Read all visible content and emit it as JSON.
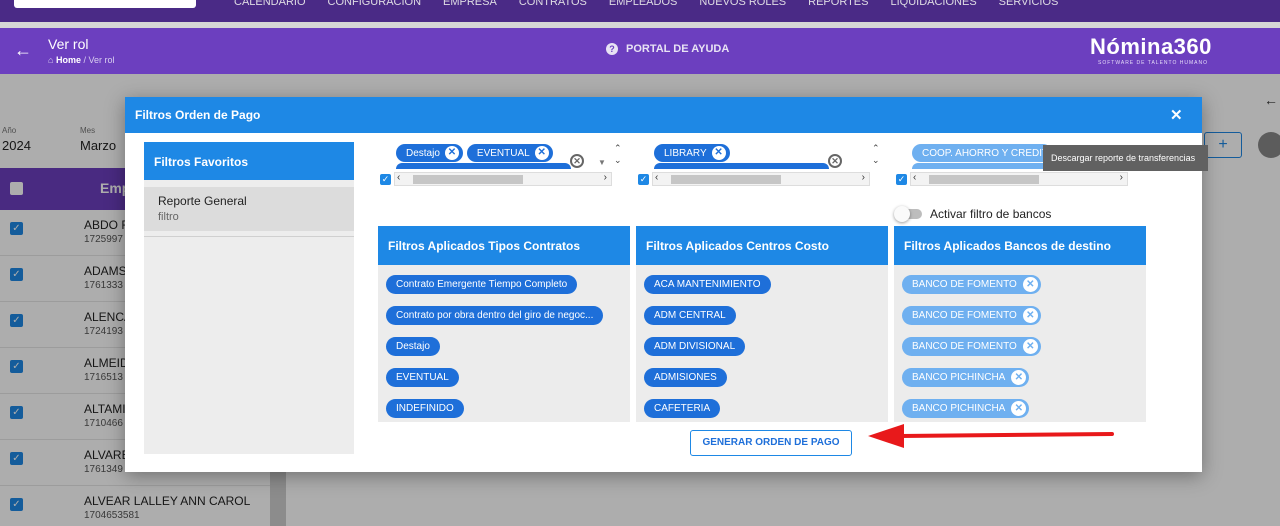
{
  "topnav": {
    "items": [
      "CALENDARIO",
      "CONFIGURACIÓN",
      "EMPRESA",
      "CONTRATOS",
      "EMPLEADOS",
      "NUEVOS ROLES",
      "REPORTES",
      "LIQUIDACIONES",
      "SERVICIOS"
    ]
  },
  "header": {
    "title": "Ver rol",
    "breadcrumb_home": "Home",
    "breadcrumb_current": "/ Ver rol",
    "help": "PORTAL DE AYUDA",
    "brand": "Nómina360",
    "tagline": "SOFTWARE DE TALENTO HUMANO"
  },
  "background": {
    "year_label": "Año",
    "year": "2024",
    "month_label": "Mes",
    "month": "Marzo",
    "table_header": "Emp",
    "rows": [
      {
        "name": "ABDO F",
        "id": "1725997"
      },
      {
        "name": "ADAMS",
        "id": "1761333"
      },
      {
        "name": "ALENCA",
        "id": "1724193"
      },
      {
        "name": "ALMEID",
        "id": "1716513"
      },
      {
        "name": "ALTAMI",
        "id": "1710466"
      },
      {
        "name": "ALVARE",
        "id": "1761349"
      },
      {
        "name": "ALVEAR LALLEY ANN CAROL",
        "id": "1704653581"
      }
    ],
    "plus": "+"
  },
  "modal": {
    "title": "Filtros Orden de Pago",
    "close": "✕",
    "favorites": {
      "header": "Filtros Favoritos",
      "items": [
        {
          "name": "Reporte General",
          "subtitle": "filtro"
        }
      ]
    },
    "selectors": {
      "contracts": {
        "chips": [
          "Destajo",
          "EVENTUAL"
        ]
      },
      "cost_centers": {
        "chips": [
          "LIBRARY"
        ]
      },
      "banks": {
        "chips": [
          "COOP. AHORRO Y CREDIT"
        ]
      }
    },
    "bank_toggle_label": "Activar filtro de bancos",
    "panels": {
      "contracts": {
        "header": "Filtros Aplicados Tipos Contratos",
        "items": [
          "Contrato Emergente Tiempo Completo",
          "Contrato por obra dentro del giro de negoc...",
          "Destajo",
          "EVENTUAL",
          "INDEFINIDO"
        ]
      },
      "cost_centers": {
        "header": "Filtros Aplicados Centros Costo",
        "items": [
          "ACA MANTENIMIENTO",
          "ADM CENTRAL",
          "ADM DIVISIONAL",
          "ADMISIONES",
          "CAFETERIA"
        ]
      },
      "banks": {
        "header": "Filtros Aplicados Bancos de destino",
        "items": [
          "BANCO DE FOMENTO",
          "BANCO DE FOMENTO",
          "BANCO DE FOMENTO",
          "BANCO PICHINCHA",
          "BANCO PICHINCHA"
        ]
      }
    },
    "generate_button": "GENERAR ORDEN DE PAGO"
  },
  "tooltip": "Descargar reporte de transferencias",
  "colors": {
    "primary": "#1e88e5",
    "header_purple": "#6c3fbf",
    "arrow_red": "#e8191b"
  }
}
